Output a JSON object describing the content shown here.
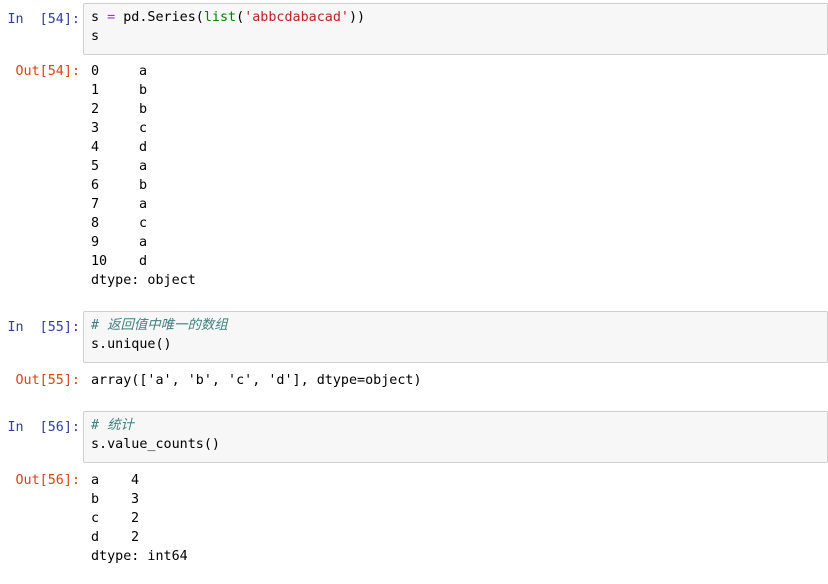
{
  "cells": [
    {
      "in_prompt": "In  [54]:",
      "code": {
        "line1": {
          "var": "s ",
          "op": "=",
          "pre": " pd.Series(",
          "builtin": "list",
          "paren": "(",
          "str": "'abbcdabacad'",
          "close": "))"
        },
        "line2": "s"
      },
      "out_prompt": "Out[54]:",
      "series": [
        {
          "index": "0",
          "value": "a"
        },
        {
          "index": "1",
          "value": "b"
        },
        {
          "index": "2",
          "value": "b"
        },
        {
          "index": "3",
          "value": "c"
        },
        {
          "index": "4",
          "value": "d"
        },
        {
          "index": "5",
          "value": "a"
        },
        {
          "index": "6",
          "value": "b"
        },
        {
          "index": "7",
          "value": "a"
        },
        {
          "index": "8",
          "value": "c"
        },
        {
          "index": "9",
          "value": "a"
        },
        {
          "index": "10",
          "value": "d"
        }
      ],
      "dtype": "dtype: object"
    },
    {
      "in_prompt": "In  [55]:",
      "code": {
        "comment": "# 返回值中唯一的数组",
        "line2": "s.unique()"
      },
      "out_prompt": "Out[55]:",
      "output": "array(['a', 'b', 'c', 'd'], dtype=object)"
    },
    {
      "in_prompt": "In  [56]:",
      "code": {
        "comment": "# 统计",
        "line2": "s.value_counts()"
      },
      "out_prompt": "Out[56]:",
      "counts": [
        {
          "key": "a",
          "count": "4"
        },
        {
          "key": "b",
          "count": "3"
        },
        {
          "key": "c",
          "count": "2"
        },
        {
          "key": "d",
          "count": "2"
        }
      ],
      "dtype": "dtype: int64"
    }
  ],
  "colors": {
    "in_prompt": "#303f9f",
    "out_prompt": "#d84315",
    "input_bg": "#f7f7f7",
    "input_border": "#cfcfcf",
    "keyword_op": "#aa22ff",
    "builtin": "#008000",
    "string": "#ba2121",
    "comment": "#408080"
  }
}
